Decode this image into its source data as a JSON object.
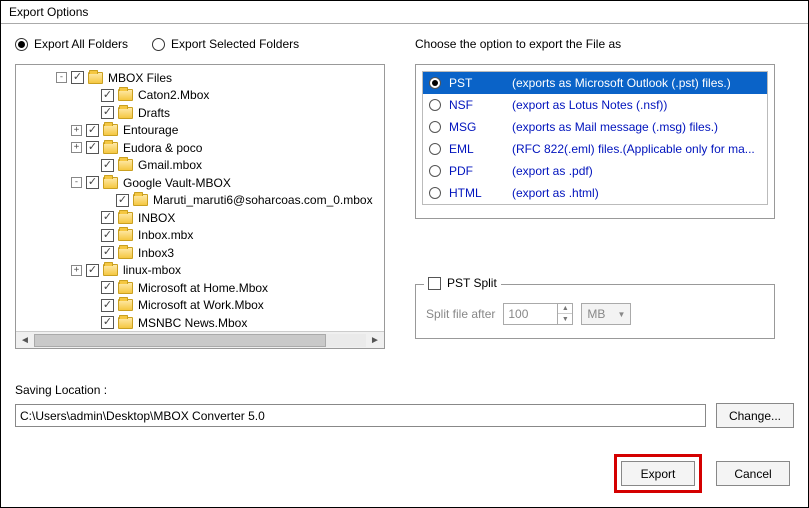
{
  "window": {
    "title": "Export Options"
  },
  "scope": {
    "all_label": "Export All Folders",
    "selected_label": "Export Selected Folders",
    "choice": "all"
  },
  "tree": {
    "items": [
      {
        "indent": 40,
        "expander": "-",
        "label": "MBOX Files"
      },
      {
        "indent": 70,
        "expander": "",
        "label": "Caton2.Mbox"
      },
      {
        "indent": 70,
        "expander": "",
        "label": "Drafts"
      },
      {
        "indent": 55,
        "expander": "+",
        "label": "Entourage"
      },
      {
        "indent": 55,
        "expander": "+",
        "label": "Eudora & poco"
      },
      {
        "indent": 70,
        "expander": "",
        "label": "Gmail.mbox"
      },
      {
        "indent": 55,
        "expander": "-",
        "label": "Google Vault-MBOX"
      },
      {
        "indent": 85,
        "expander": "",
        "label": "Maruti_maruti6@soharcoas.com_0.mbox"
      },
      {
        "indent": 70,
        "expander": "",
        "label": "INBOX"
      },
      {
        "indent": 70,
        "expander": "",
        "label": "Inbox.mbx"
      },
      {
        "indent": 70,
        "expander": "",
        "label": "Inbox3"
      },
      {
        "indent": 55,
        "expander": "+",
        "label": "linux-mbox"
      },
      {
        "indent": 70,
        "expander": "",
        "label": "Microsoft at Home.Mbox"
      },
      {
        "indent": 70,
        "expander": "",
        "label": "Microsoft at Work.Mbox"
      },
      {
        "indent": 70,
        "expander": "",
        "label": "MSNBC News.Mbox"
      }
    ]
  },
  "formats": {
    "heading": "Choose the option to export the File as",
    "items": [
      {
        "name": "PST",
        "desc": "(exports as Microsoft Outlook (.pst) files.)",
        "selected": true
      },
      {
        "name": "NSF",
        "desc": "(export as Lotus Notes (.nsf))",
        "selected": false
      },
      {
        "name": "MSG",
        "desc": "(exports as Mail message (.msg) files.)",
        "selected": false
      },
      {
        "name": "EML",
        "desc": "(RFC 822(.eml) files.(Applicable only for ma...",
        "selected": false
      },
      {
        "name": "PDF",
        "desc": "(export as .pdf)",
        "selected": false
      },
      {
        "name": "HTML",
        "desc": "(export as .html)",
        "selected": false
      }
    ]
  },
  "split": {
    "legend": "PST Split",
    "label": "Split file after",
    "value": "100",
    "unit": "MB"
  },
  "save": {
    "label": "Saving Location :",
    "path": "C:\\Users\\admin\\Desktop\\MBOX Converter 5.0",
    "change_btn": "Change..."
  },
  "buttons": {
    "export": "Export",
    "cancel": "Cancel"
  }
}
